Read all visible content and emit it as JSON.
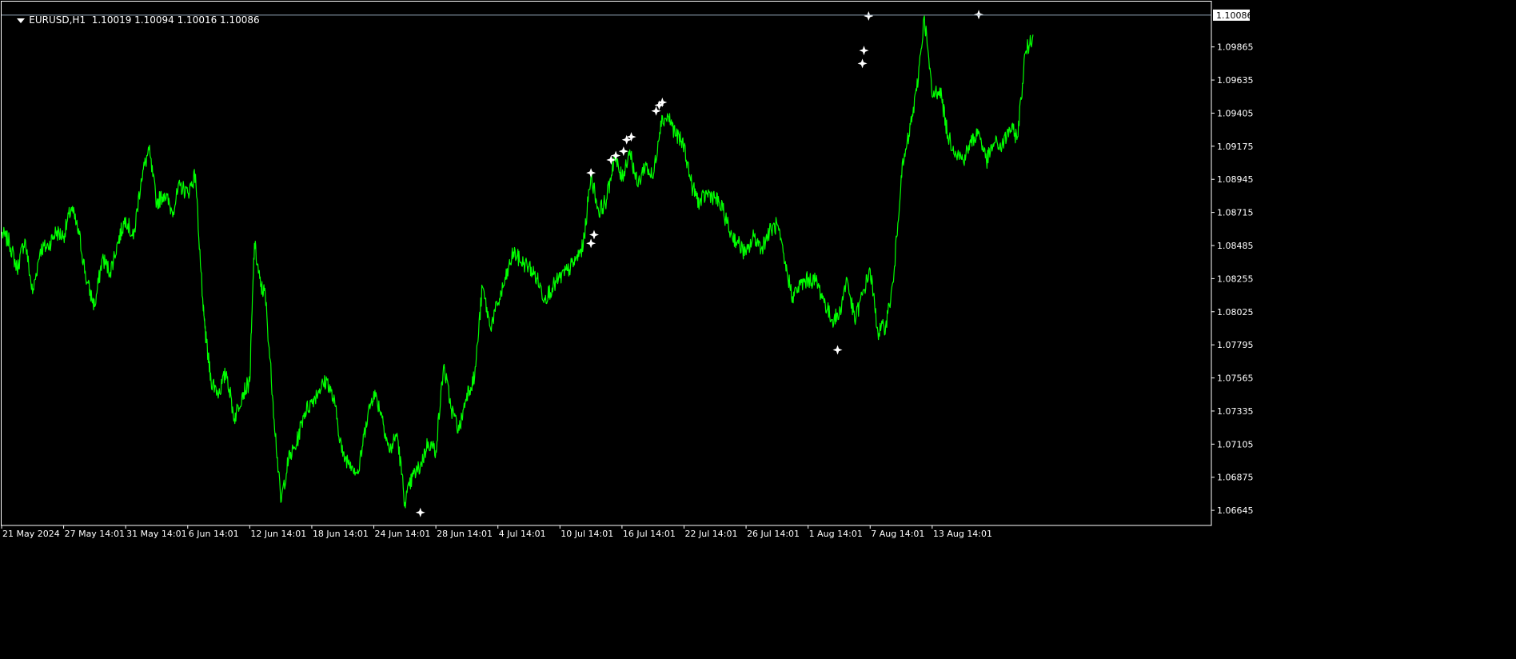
{
  "header": {
    "symbol_tf": "EURUSD,H1",
    "ohlc": "1.10019 1.10094 1.10016 1.10086"
  },
  "colors": {
    "background": "#000000",
    "line": "#00ff00",
    "axis": "#ffffff",
    "bid_line": "#8fa3b5",
    "marker": "#ffffff"
  },
  "chart_data": {
    "type": "line",
    "title": "EURUSD,H1",
    "xlabel": "",
    "ylabel": "",
    "ylim": [
      1.0654,
      1.1018
    ],
    "grid": false,
    "y_ticks": [
      "1.09865",
      "1.09635",
      "1.09405",
      "1.09175",
      "1.08945",
      "1.08715",
      "1.08485",
      "1.08255",
      "1.08025",
      "1.07795",
      "1.07565",
      "1.07335",
      "1.07105",
      "1.06875",
      "1.06645"
    ],
    "x_ticks": [
      {
        "label": "21 May 2024",
        "index": 0
      },
      {
        "label": "27 May 14:01",
        "index": 4
      },
      {
        "label": "31 May 14:01",
        "index": 8
      },
      {
        "label": "6 Jun 14:01",
        "index": 12
      },
      {
        "label": "12 Jun 14:01",
        "index": 16
      },
      {
        "label": "18 Jun 14:01",
        "index": 20
      },
      {
        "label": "24 Jun 14:01",
        "index": 24
      },
      {
        "label": "28 Jun 14:01",
        "index": 28
      },
      {
        "label": "4 Jul 14:01",
        "index": 32
      },
      {
        "label": "10 Jul 14:01",
        "index": 36
      },
      {
        "label": "16 Jul 14:01",
        "index": 40
      },
      {
        "label": "22 Jul 14:01",
        "index": 44
      },
      {
        "label": "26 Jul 14:01",
        "index": 48
      },
      {
        "label": "1 Aug 14:01",
        "index": 52
      },
      {
        "label": "7 Aug 14:01",
        "index": 56
      },
      {
        "label": "13 Aug 14:01",
        "index": 60
      }
    ],
    "current_price": "1.10086",
    "series": [
      {
        "values": [
          [
            0,
            1.0857
          ],
          [
            0.5,
            1.0851
          ],
          [
            1,
            1.0832
          ],
          [
            1.5,
            1.0853
          ],
          [
            2,
            1.0815
          ],
          [
            2.5,
            1.0846
          ],
          [
            3,
            1.0848
          ],
          [
            3.5,
            1.0858
          ],
          [
            4,
            1.0855
          ],
          [
            4.5,
            1.0875
          ],
          [
            5,
            1.0856
          ],
          [
            5.5,
            1.0823
          ],
          [
            6,
            1.0806
          ],
          [
            6.5,
            1.084
          ],
          [
            7,
            1.083
          ],
          [
            7.5,
            1.0851
          ],
          [
            8,
            1.0868
          ],
          [
            8.5,
            1.0853
          ],
          [
            9,
            1.0895
          ],
          [
            9.5,
            1.0915
          ],
          [
            10,
            1.0878
          ],
          [
            10.5,
            1.0885
          ],
          [
            11,
            1.0872
          ],
          [
            11.5,
            1.089
          ],
          [
            12,
            1.0885
          ],
          [
            12.5,
            1.0898
          ],
          [
            13,
            1.0803
          ],
          [
            13.2,
            1.0781
          ],
          [
            13.5,
            1.0755
          ],
          [
            14,
            1.0746
          ],
          [
            14.5,
            1.0761
          ],
          [
            15,
            1.0728
          ],
          [
            15.5,
            1.0745
          ],
          [
            16,
            1.0754
          ],
          [
            16.3,
            1.085
          ],
          [
            16.7,
            1.082
          ],
          [
            17,
            1.0815
          ],
          [
            17.5,
            1.074
          ],
          [
            18,
            1.067
          ],
          [
            18.5,
            1.07
          ],
          [
            19,
            1.071
          ],
          [
            19.5,
            1.0732
          ],
          [
            20,
            1.074
          ],
          [
            20.5,
            1.0749
          ],
          [
            21,
            1.0755
          ],
          [
            21.5,
            1.0737
          ],
          [
            22,
            1.0702
          ],
          [
            22.5,
            1.0698
          ],
          [
            23,
            1.069
          ],
          [
            23.5,
            1.0726
          ],
          [
            24,
            1.0747
          ],
          [
            24.5,
            1.0732
          ],
          [
            25,
            1.0705
          ],
          [
            25.5,
            1.0718
          ],
          [
            26,
            1.067
          ],
          [
            26.5,
            1.0688
          ],
          [
            27,
            1.0695
          ],
          [
            27.5,
            1.0712
          ],
          [
            28,
            1.0706
          ],
          [
            28.5,
            1.0765
          ],
          [
            29,
            1.0735
          ],
          [
            29.5,
            1.072
          ],
          [
            30,
            1.0746
          ],
          [
            30.5,
            1.0757
          ],
          [
            31,
            1.082
          ],
          [
            31.5,
            1.0792
          ],
          [
            32,
            1.0808
          ],
          [
            32.5,
            1.0825
          ],
          [
            33,
            1.0844
          ],
          [
            33.5,
            1.0837
          ],
          [
            34,
            1.0834
          ],
          [
            34.5,
            1.0826
          ],
          [
            35,
            1.0812
          ],
          [
            35.5,
            1.0819
          ],
          [
            36,
            1.0826
          ],
          [
            36.5,
            1.0831
          ],
          [
            37,
            1.0838
          ],
          [
            37.5,
            1.0848
          ],
          [
            38,
            1.0898
          ],
          [
            38.5,
            1.0872
          ],
          [
            39,
            1.088
          ],
          [
            39.5,
            1.091
          ],
          [
            40,
            1.0895
          ],
          [
            40.5,
            1.0915
          ],
          [
            41,
            1.089
          ],
          [
            41.5,
            1.0905
          ],
          [
            42,
            1.0895
          ],
          [
            42.5,
            1.0935
          ],
          [
            43,
            1.0938
          ],
          [
            43.5,
            1.0925
          ],
          [
            44,
            1.0918
          ],
          [
            44.5,
            1.089
          ],
          [
            45,
            1.0878
          ],
          [
            45.5,
            1.0885
          ],
          [
            46,
            1.0882
          ],
          [
            46.5,
            1.0873
          ],
          [
            47,
            1.0857
          ],
          [
            47.5,
            1.085
          ],
          [
            48,
            1.0842
          ],
          [
            48.5,
            1.0855
          ],
          [
            49,
            1.0847
          ],
          [
            49.5,
            1.0858
          ],
          [
            50,
            1.0863
          ],
          [
            50.5,
            1.0836
          ],
          [
            51,
            1.0813
          ],
          [
            51.5,
            1.0821
          ],
          [
            52,
            1.0825
          ],
          [
            52.5,
            1.0824
          ],
          [
            53,
            1.0811
          ],
          [
            53.5,
            1.0797
          ],
          [
            54,
            1.08
          ],
          [
            54.5,
            1.0826
          ],
          [
            55,
            1.0796
          ],
          [
            55.5,
            1.0814
          ],
          [
            56,
            1.0832
          ],
          [
            56.5,
            1.0788
          ],
          [
            57,
            1.0793
          ],
          [
            57.5,
            1.0823
          ],
          [
            58,
            1.0897
          ],
          [
            58.5,
            1.0925
          ],
          [
            59,
            1.0956
          ],
          [
            59.5,
            1.1008
          ],
          [
            60,
            1.0952
          ],
          [
            60.5,
            1.0958
          ],
          [
            61,
            1.0925
          ],
          [
            61.5,
            1.0914
          ],
          [
            62,
            1.0908
          ],
          [
            62.5,
            1.092
          ],
          [
            63,
            1.0928
          ],
          [
            63.5,
            1.0907
          ],
          [
            64,
            1.092
          ],
          [
            64.5,
            1.0917
          ],
          [
            65,
            1.093
          ],
          [
            65.5,
            1.0924
          ],
          [
            66,
            1.0982
          ],
          [
            66.5,
            1.0995
          ]
        ]
      }
    ],
    "markers": [
      [
        27.0,
        1.0663
      ],
      [
        38.0,
        1.0899
      ],
      [
        38.2,
        1.0856
      ],
      [
        38.0,
        1.085
      ],
      [
        39.3,
        1.0908
      ],
      [
        39.6,
        1.0911
      ],
      [
        40.1,
        1.0914
      ],
      [
        40.3,
        1.0922
      ],
      [
        40.6,
        1.0924
      ],
      [
        42.2,
        1.0942
      ],
      [
        42.4,
        1.0946
      ],
      [
        42.6,
        1.0948
      ],
      [
        53.9,
        1.0776
      ],
      [
        55.5,
        1.0975
      ],
      [
        55.6,
        1.0984
      ],
      [
        55.9,
        1.1008
      ],
      [
        63.0,
        1.1009
      ]
    ],
    "x_range": [
      0,
      78
    ]
  }
}
